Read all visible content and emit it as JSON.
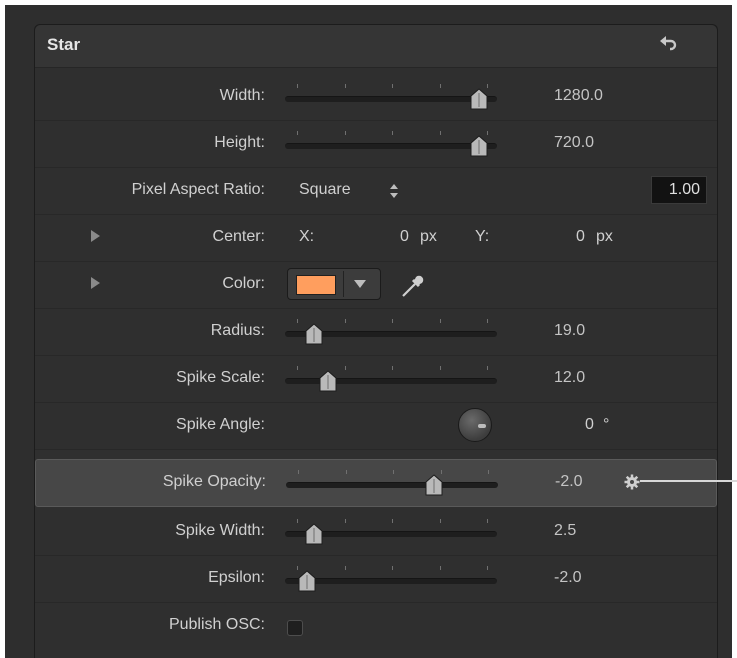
{
  "header": {
    "title": "Star",
    "reset_icon": "reset-arrow-icon"
  },
  "rows": {
    "width": {
      "label": "Width:",
      "value": "1280.0"
    },
    "height": {
      "label": "Height:",
      "value": "720.0"
    },
    "par": {
      "label": "Pixel Aspect Ratio:",
      "popup": "Square",
      "popup_icon": "up-down-chevron-icon",
      "number": "1.00"
    },
    "center": {
      "label": "Center:",
      "x_label": "X:",
      "x_value": "0",
      "x_unit": "px",
      "y_label": "Y:",
      "y_value": "0",
      "y_unit": "px"
    },
    "color": {
      "label": "Color:",
      "swatch": "#ff9e5e",
      "eyedropper_icon": "eyedropper-icon"
    },
    "radius": {
      "label": "Radius:",
      "value": "19.0"
    },
    "spike_scale": {
      "label": "Spike Scale:",
      "value": "12.0"
    },
    "spike_angle": {
      "label": "Spike Angle:",
      "value": "0",
      "unit": "°"
    },
    "spike_opacity": {
      "label": "Spike Opacity:",
      "value": "-2.0",
      "gear_icon": "gear-icon"
    },
    "spike_width": {
      "label": "Spike Width:",
      "value": "2.5"
    },
    "epsilon": {
      "label": "Epsilon:",
      "value": "-2.0"
    },
    "publish_osc": {
      "label": "Publish OSC:",
      "checked": false
    }
  },
  "sliders": {
    "width": 0.96,
    "height": 0.96,
    "radius": 0.1,
    "spike_scale": 0.17,
    "spike_opacity": 0.72,
    "spike_width": 0.1,
    "epsilon": 0.06
  },
  "colors": {
    "panel": "#2f2f2f",
    "accent_swatch": "#ff9e5e"
  }
}
